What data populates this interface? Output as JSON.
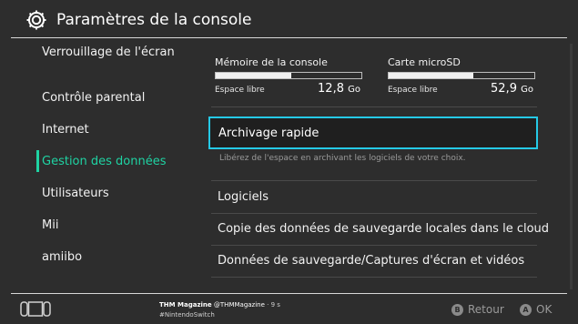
{
  "header": {
    "title": "Paramètres de la console",
    "icon": "gear-icon"
  },
  "sidebar": {
    "items": [
      {
        "label": "Verrouillage de l'écran",
        "active": false
      },
      {
        "label": "Contrôle parental",
        "active": false
      },
      {
        "label": "Internet",
        "active": false
      },
      {
        "label": "Gestion des données",
        "active": true
      },
      {
        "label": "Utilisateurs",
        "active": false
      },
      {
        "label": "Mii",
        "active": false
      },
      {
        "label": "amiibo",
        "active": false
      }
    ]
  },
  "storage": {
    "console": {
      "name": "Mémoire de la console",
      "free_label": "Espace libre",
      "free_value": "12,8",
      "unit": "Go",
      "used_fraction": 0.52
    },
    "sd": {
      "name": "Carte microSD",
      "free_label": "Espace libre",
      "free_value": "52,9",
      "unit": "Go",
      "used_fraction": 0.58
    }
  },
  "main": {
    "archive": {
      "label": "Archivage rapide",
      "description": "Libérez de l'espace en archivant les logiciels de votre choix."
    },
    "items": [
      {
        "label": "Logiciels"
      },
      {
        "label": "Copie des données de sauvegarde locales dans le cloud"
      },
      {
        "label": "Données de sauvegarde/Captures d'écran et vidéos"
      }
    ]
  },
  "footer": {
    "notification": {
      "name": "THM Magazine",
      "handle": "@THMMagazine",
      "time": "· 9 s",
      "tag": "#NintendoSwitch"
    },
    "back": {
      "button": "B",
      "label": "Retour"
    },
    "ok": {
      "button": "A",
      "label": "OK"
    }
  },
  "colors": {
    "accent": "#1fd3a3",
    "focus": "#25c9e6",
    "background": "#2d2d2d"
  }
}
